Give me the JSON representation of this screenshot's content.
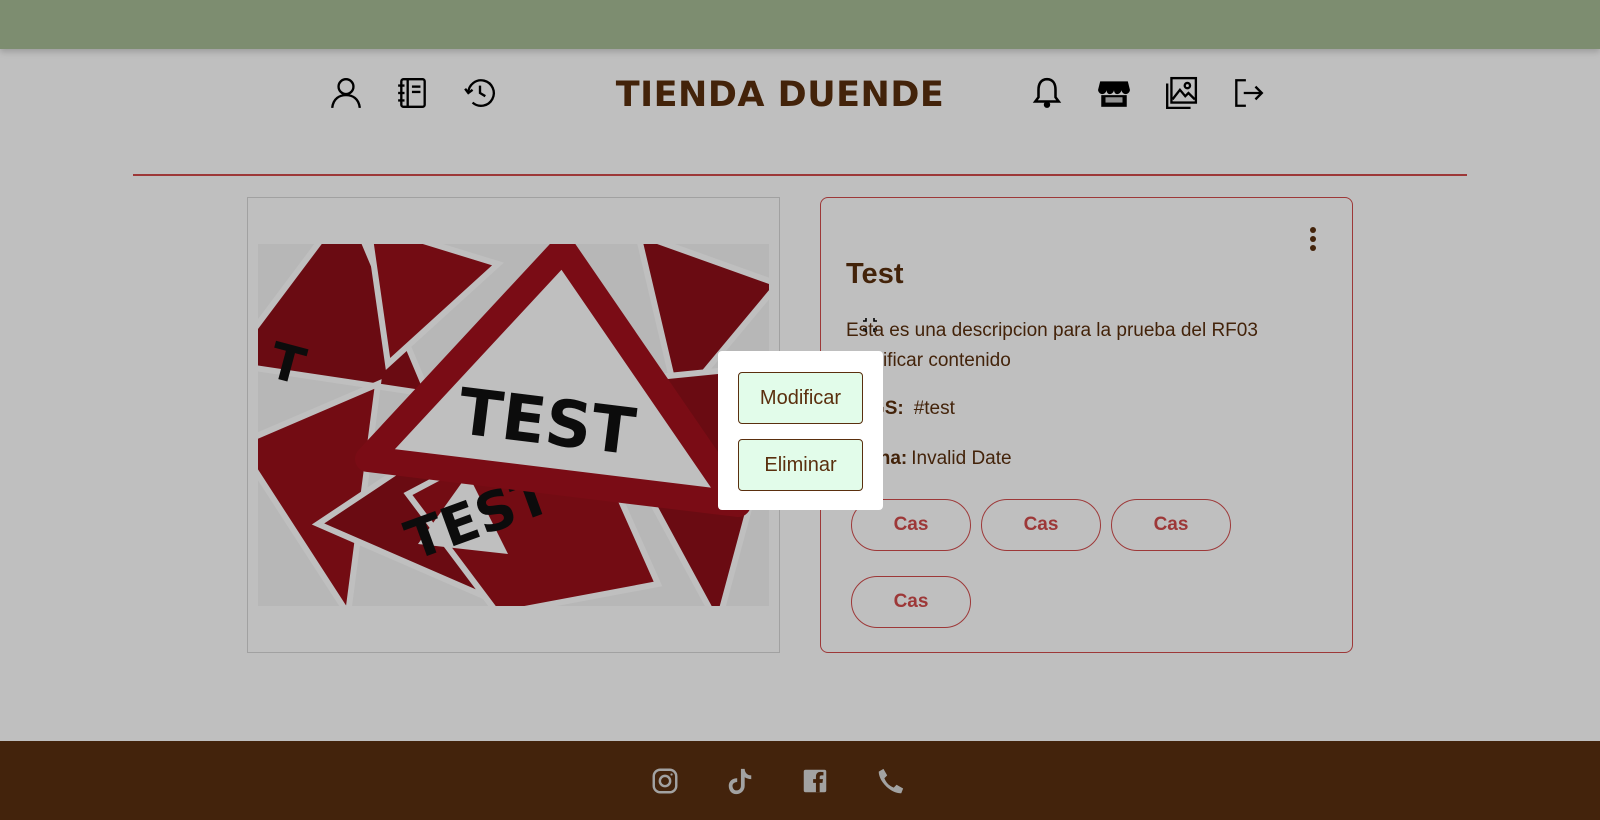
{
  "app": {
    "brand": "TIENDA DUENDE",
    "colors": {
      "topbar": "#a7bc96",
      "brand_brown": "#5a2f0e",
      "accent_red": "#d24b4b",
      "footer": "#5a2f10",
      "button_green": "#e2fcea"
    }
  },
  "header": {
    "left_icons": [
      "user-icon",
      "notebook-icon",
      "history-icon"
    ],
    "right_icons": [
      "bell-icon",
      "store-icon",
      "images-icon",
      "logout-icon"
    ]
  },
  "post": {
    "image_caption_text": "TEST",
    "title": "Test",
    "description": "Esta es una descripcion para la prueba del RF03 modificar contenido",
    "tags_label": "TAGS:",
    "tags_value": "#test",
    "date_label": "Fecha:",
    "date_value": "Invalid Date",
    "categories": [
      "Cas",
      "Cas",
      "Cas",
      "Cas"
    ]
  },
  "menu_popup": {
    "modify_label": "Modificar",
    "delete_label": "Eliminar"
  },
  "footer": {
    "icons": [
      "instagram-icon",
      "tiktok-icon",
      "facebook-icon",
      "phone-icon"
    ]
  }
}
